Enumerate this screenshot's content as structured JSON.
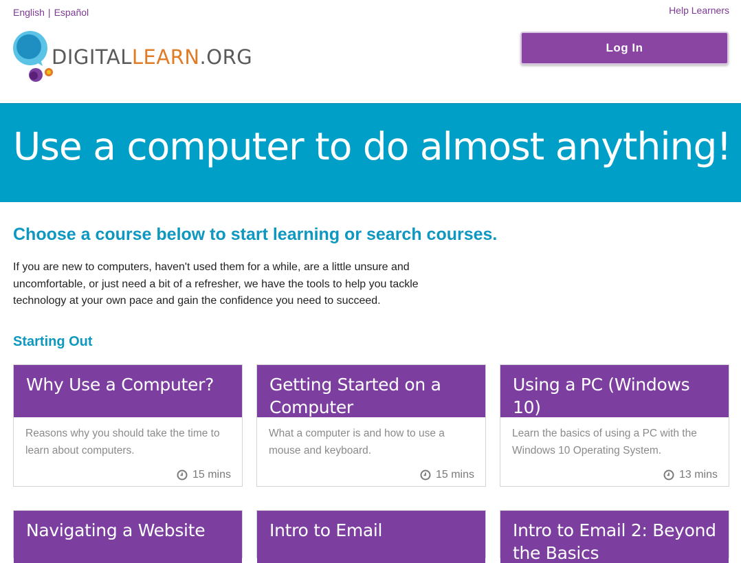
{
  "header": {
    "lang_english": "English",
    "lang_separator": "|",
    "lang_espanol": "Español",
    "help_link": "Help Learners",
    "logo_text_1": "DIGITAL",
    "logo_text_2": "LEARN",
    "logo_text_3": ".ORG",
    "login_label": "Log In"
  },
  "hero": {
    "title": "Use a computer to do almost anything!"
  },
  "intro": {
    "title": "Choose a course below to start learning or search courses.",
    "text": "If you are new to computers, haven't used them for a while, are a little unsure and uncomfortable, or just need a bit of a refresher, we have the tools to help you tackle technology at your own pace and gain the confidence you need to succeed."
  },
  "section": {
    "title": "Starting Out"
  },
  "courses": [
    {
      "title": "Why Use a Computer?",
      "description": "Reasons why you should take the time to learn about computers.",
      "time": "15 mins"
    },
    {
      "title": "Getting Started on a Computer",
      "description": "What a computer is and how to use a mouse and keyboard.",
      "time": "15 mins"
    },
    {
      "title": "Using a PC (Windows 10)",
      "description": "Learn the basics of using a PC with the Windows 10 Operating System.",
      "time": "13 mins"
    },
    {
      "title": "Navigating a Website"
    },
    {
      "title": "Intro to Email"
    },
    {
      "title": "Intro to Email 2: Beyond the Basics"
    }
  ],
  "colors": {
    "purple": "#7c3fa0",
    "teal": "#009fc8",
    "accent_orange": "#e07b26"
  },
  "icons": {
    "clock": "clock-icon"
  }
}
